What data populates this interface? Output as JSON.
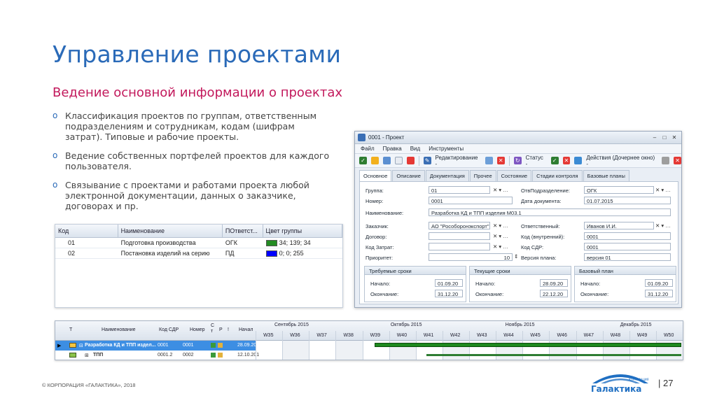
{
  "slide": {
    "title": "Управление проектами",
    "subtitle": "Ведение основной информации о проектах",
    "bullets": [
      "Классификация проектов по группам, ответственным подразделениям и сотрудникам, кодам (шифрам затрат). Типовые и рабочие проекты.",
      "Ведение собственных портфелей проектов для каждого пользователя.",
      "Связывание с проектами и работами проекта любой электронной документации, данных о заказчике, договорах и пр."
    ],
    "footer": "© КОРПОРАЦИЯ «ГАЛАКТИКА», 2018",
    "page_number": "| 27",
    "logo_small": "КОРПОРАЦИЯ",
    "logo_text": "Галактика"
  },
  "groups": {
    "headers": [
      "Код",
      "Наименование",
      "ПОтветст...",
      "Цвет группы"
    ],
    "rows": [
      {
        "code": "01",
        "name": "Подготовка производства",
        "resp": "ОГК",
        "color_label": "34; 139; 34",
        "color": "#228b22"
      },
      {
        "code": "02",
        "name": "Постановка изделий на серию",
        "resp": "ПД",
        "color_label": "0; 0; 255",
        "color": "#0000ff"
      }
    ]
  },
  "window": {
    "title": "0001 - Проект",
    "menu": [
      "Файл",
      "Правка",
      "Вид",
      "Инструменты"
    ],
    "toolbar": {
      "edit": "Редактирование -",
      "status": "Статус -",
      "actions": "Действия (Дочернее окно) -"
    },
    "tabs": [
      "Основное",
      "Описание",
      "Документация",
      "Прочее",
      "Состояние",
      "Стадии контроля",
      "Базовые планы"
    ],
    "fields": {
      "group_label": "Группа:",
      "group_value": "01",
      "number_label": "Номер:",
      "number_value": "0001",
      "name_label": "Наименование:",
      "name_value": "Разработка КД и ТПП изделия М03.1",
      "customer_label": "Заказчик:",
      "customer_value": "АО \"Рособоронэкспорт\"",
      "contract_label": "Договор:",
      "costcode_label": "Код Затрат:",
      "priority_label": "Приоритет:",
      "priority_value": "10",
      "dept_label": "ОтвПодразделение:",
      "dept_value": "ОГК",
      "docdate_label": "Дата документа:",
      "docdate_value": "01.07.2015",
      "resp_label": "Ответственный:",
      "resp_value": "Иванов И.И.",
      "intcode_label": "Код (внутренний):",
      "intcode_value": "0001",
      "wbs_label": "Код СДР:",
      "wbs_value": "0001",
      "planver_label": "Версия плана:",
      "planver_value": "версия 01"
    },
    "boxes": [
      {
        "title": "Требуемые сроки",
        "start_label": "Начало:",
        "start": "01.09.20",
        "end_label": "Окончание:",
        "end": "31.12.20"
      },
      {
        "title": "Текущие сроки",
        "start_label": "Начало:",
        "start": "28.09.20",
        "end_label": "Окончание:",
        "end": "22.12.20"
      },
      {
        "title": "Базовый план",
        "start_label": "Начало:",
        "start": "01.09.20",
        "end_label": "Окончание:",
        "end": "31.12.20"
      }
    ]
  },
  "gantt": {
    "headers": {
      "t": "Т",
      "name": "Наименование",
      "wbs": "Код СДР",
      "number": "Номер",
      "ct": "С т",
      "r": "Р",
      "i": "!",
      "start": "Начал"
    },
    "months": [
      "Сентябрь 2015",
      "Октябрь 2015",
      "Ноябрь 2015",
      "Декабрь 2015"
    ],
    "weeks": [
      "W35",
      "W36",
      "W37",
      "W38",
      "W39",
      "W40",
      "W41",
      "W42",
      "W43",
      "W44",
      "W45",
      "W46",
      "W47",
      "W48",
      "W49",
      "W50"
    ],
    "rows": [
      {
        "name": "Разработка КД и ТПП издел...",
        "wbs": "0001",
        "number": "0001",
        "start": "28.09.201",
        "selected": true
      },
      {
        "name": "ТПП",
        "wbs": "0001.2",
        "number": "0002",
        "start": "12.10.201",
        "selected": false
      }
    ]
  }
}
